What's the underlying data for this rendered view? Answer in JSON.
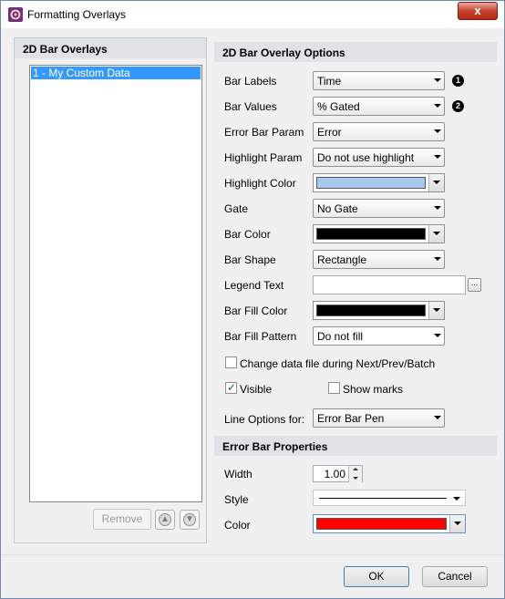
{
  "window": {
    "title": "Formatting Overlays",
    "close_glyph": "x"
  },
  "left_panel": {
    "header": "2D Bar Overlays",
    "items": [
      {
        "label": "1 - My Custom Data"
      }
    ],
    "remove_label": "Remove",
    "move_up_icon": "arrow-up-icon",
    "move_down_icon": "arrow-down-icon"
  },
  "options": {
    "header": "2D Bar Overlay Options",
    "bar_labels": {
      "label": "Bar Labels",
      "value": "Time",
      "badge": "1"
    },
    "bar_values": {
      "label": "Bar Values",
      "value": "% Gated",
      "badge": "2"
    },
    "error_bar_param": {
      "label": "Error Bar Param",
      "value": "Error"
    },
    "highlight_param": {
      "label": "Highlight Param",
      "value": "Do not use highlight"
    },
    "highlight_color": {
      "label": "Highlight Color",
      "color": "#a7c9ee"
    },
    "gate": {
      "label": "Gate",
      "value": "No Gate"
    },
    "bar_color": {
      "label": "Bar Color",
      "color": "#000000"
    },
    "bar_shape": {
      "label": "Bar Shape",
      "value": "Rectangle"
    },
    "legend_text": {
      "label": "Legend Text",
      "value": "",
      "button": "..."
    },
    "bar_fill_color": {
      "label": "Bar Fill Color",
      "color": "#000000"
    },
    "bar_fill_pattern": {
      "label": "Bar Fill Pattern",
      "value": "Do not fill"
    },
    "change_data_file": {
      "label": "Change data file during Next/Prev/Batch",
      "checked": false
    },
    "visible": {
      "label": "Visible",
      "checked": true
    },
    "show_marks": {
      "label": "Show marks",
      "checked": false
    },
    "line_options": {
      "label": "Line Options for:",
      "value": "Error Bar Pen"
    }
  },
  "error_bar": {
    "header": "Error Bar Properties",
    "width": {
      "label": "Width",
      "value": "1.00"
    },
    "style": {
      "label": "Style"
    },
    "color": {
      "label": "Color",
      "color": "#ff0000"
    }
  },
  "footer": {
    "ok_label": "OK",
    "cancel_label": "Cancel"
  }
}
